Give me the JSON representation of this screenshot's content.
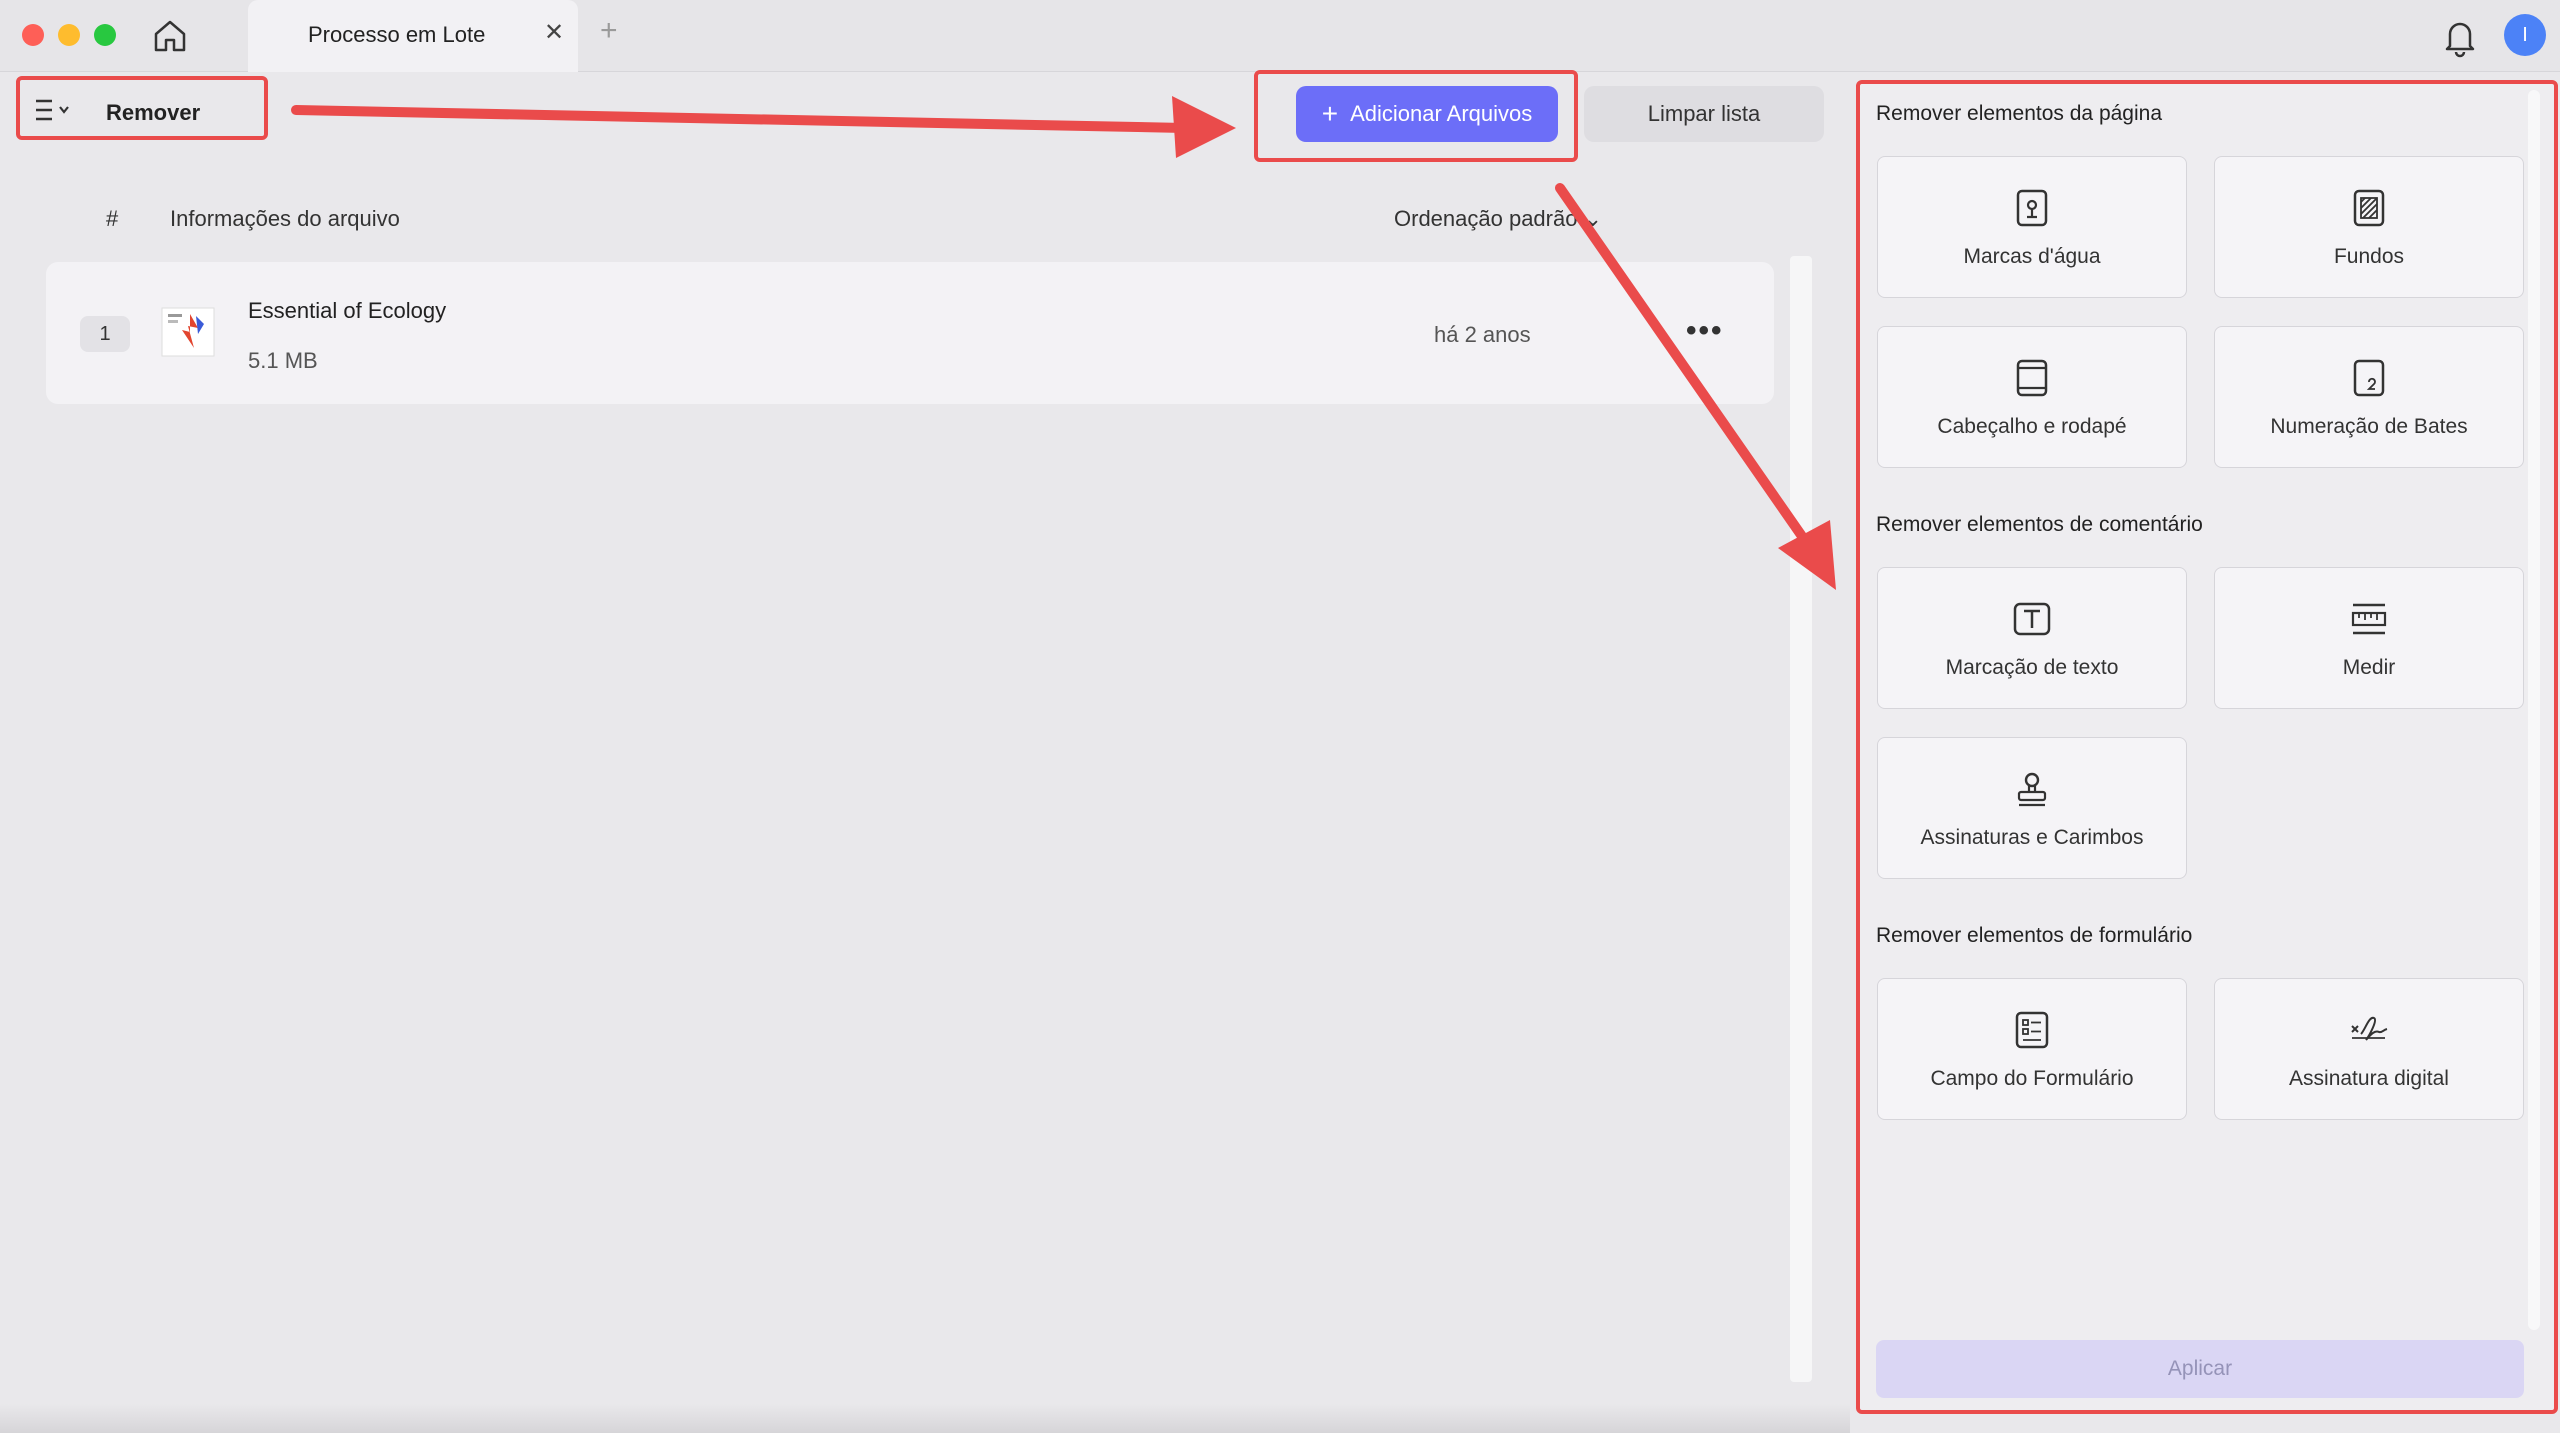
{
  "window": {
    "tab_title": "Processo em Lote",
    "tab_close": "✕",
    "tab_add": "+",
    "avatar_initial": "I"
  },
  "toolbar": {
    "mode_label": "Remover",
    "add_files_icon": "+",
    "add_files_label": "Adicionar Arquivos",
    "clear_label": "Limpar lista"
  },
  "list": {
    "col_number": "#",
    "col_info": "Informações do arquivo",
    "sort_label": "Ordenação padrão",
    "sort_caret": "⌄",
    "files": [
      {
        "index": "1",
        "name": "Essential of Ecology",
        "size": "5.1 MB",
        "date": "há 2 anos",
        "more": "•••"
      }
    ]
  },
  "panel": {
    "page_section": "Remover elementos da página",
    "comment_section": "Remover elementos de comentário",
    "form_section": "Remover elementos de formulário",
    "cards": [
      {
        "label": "Marcas d'água",
        "icon": "watermark-icon"
      },
      {
        "label": "Fundos",
        "icon": "background-icon"
      },
      {
        "label": "Cabeçalho e rodapé",
        "icon": "header-footer-icon"
      },
      {
        "label": "Numeração de Bates",
        "icon": "bates-numbering-icon"
      },
      {
        "label": "Marcação de texto",
        "icon": "text-markup-icon"
      },
      {
        "label": "Medir",
        "icon": "measure-icon"
      },
      {
        "label": "Assinaturas e Carimbos",
        "icon": "stamp-icon"
      },
      {
        "label": "Campo do Formulário",
        "icon": "form-field-icon"
      },
      {
        "label": "Assinatura digital",
        "icon": "digital-signature-icon"
      }
    ],
    "apply_label": "Aplicar"
  },
  "colors": {
    "accent": "#6c6ef8",
    "annotation": "#ea4b4b",
    "apply_disabled": "#dad6f4"
  }
}
